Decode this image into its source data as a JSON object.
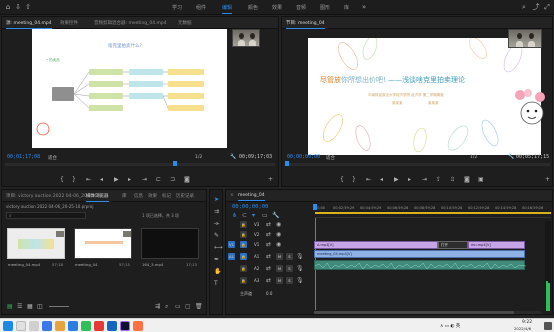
{
  "workspace_tabs": [
    "学习",
    "组件",
    "编辑",
    "颜色",
    "效果",
    "音频",
    "图形",
    "库"
  ],
  "workspace_active": 2,
  "source_panel": {
    "tabs": [
      "源: meeting_04.mp4",
      "效果控件",
      "音频剪辑混合器: meeting_04.mp4",
      "元数据"
    ],
    "active_tab": 0,
    "timecode_left": "00;01;17;08",
    "fit_label": "适合",
    "ratio": "1/2",
    "timecode_right": "00;09;17;03",
    "image": {
      "title": "啥克里拍卖什么?",
      "left_node": "• 拍卖品",
      "branches_left": [
        "——",
        "——",
        "——",
        "——"
      ],
      "branches_right": [
        "——",
        "——",
        "——",
        "——"
      ]
    }
  },
  "program_panel": {
    "tabs": [
      "节目: meeting_04"
    ],
    "timecode_left": "00;00;00;00",
    "fit_label": "适合",
    "ratio": "1/2",
    "timecode_right": "00;05;17;15",
    "slide": {
      "title_orange": "尽管放",
      "title_rest": "你所想出价吧!",
      "title_dash": "——浅谈啥克里拍卖理论",
      "subtitle": "中南财经政法大学经济学院 经济学 第二学期周报",
      "presenters": [
        "某某某",
        "某某某"
      ]
    }
  },
  "project_panel": {
    "tabs": [
      "项目: victory auction 2022 04-06_20-25-10",
      "媒体浏览器",
      "库",
      "信息",
      "效果",
      "标记",
      "历史记录"
    ],
    "project_name": "victory auction 2022 04-06_20-25-10.prproj",
    "item_count": "1 项已选择，共 3 项",
    "items": [
      {
        "name": "meeting_04.mp4",
        "duration": "57;18"
      },
      {
        "name": "meeting_04",
        "duration": "57;15"
      },
      {
        "name": "164_3.mp4",
        "duration": "17;13"
      }
    ]
  },
  "timeline_panel": {
    "tab": "meeting_04",
    "timecode": "00;00;00;00",
    "ruler_marks": [
      "00;00",
      "00;02;59;29",
      "00;04;59;29",
      "00;06;59;28",
      "00;08;59;28",
      "00;10;59;28",
      "00;12;59;28",
      "00;14;59;28",
      "00;16;59;26"
    ],
    "video_tracks": [
      "V3",
      "V2",
      "V1"
    ],
    "audio_tracks": [
      "A1",
      "A2",
      "A3"
    ],
    "master_label": "主声道",
    "master_value": "0.0",
    "clips": {
      "v1_a": "A.mp4[V]",
      "v1_b": "meeting_04.mp4[V]",
      "v1_c": "mn.mp4[V]",
      "v1_d": "打开"
    }
  },
  "taskbar": {
    "time": "9:22",
    "date": "2022/4/6"
  }
}
